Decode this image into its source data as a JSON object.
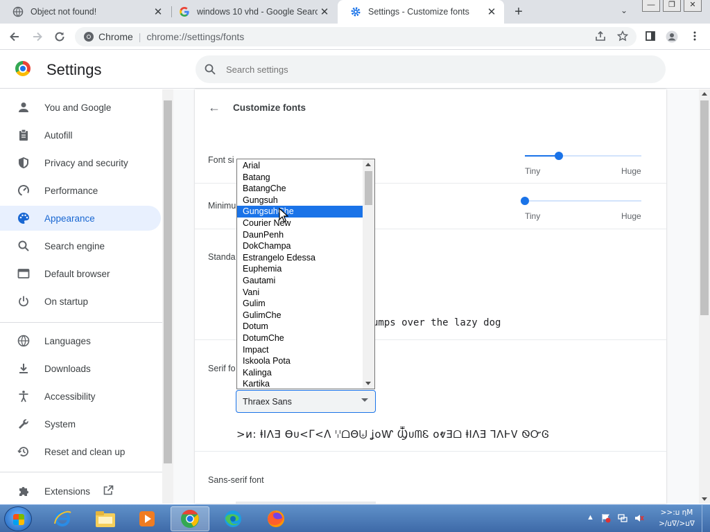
{
  "tabs": [
    {
      "title": "Object not found!",
      "icon": "globe-icon"
    },
    {
      "title": "windows 10 vhd - Google Search",
      "icon": "google-g-icon"
    },
    {
      "title": "Settings - Customize fonts",
      "icon": "gear-icon"
    }
  ],
  "tab_close": "✕",
  "new_tab": "+",
  "tab_search": "⌄",
  "window_controls": {
    "minimize": "—",
    "restore": "❐",
    "close": "✕"
  },
  "omnibox": {
    "chip": "Chrome",
    "url": "chrome://settings/fonts"
  },
  "settings": {
    "title": "Settings",
    "search_placeholder": "Search settings"
  },
  "sidebar": {
    "items": [
      {
        "label": "You and Google",
        "icon": "person-icon"
      },
      {
        "label": "Autofill",
        "icon": "clipboard-icon"
      },
      {
        "label": "Privacy and security",
        "icon": "shield-icon"
      },
      {
        "label": "Performance",
        "icon": "speedometer-icon"
      },
      {
        "label": "Appearance",
        "icon": "palette-icon"
      },
      {
        "label": "Search engine",
        "icon": "search-icon"
      },
      {
        "label": "Default browser",
        "icon": "browser-window-icon"
      },
      {
        "label": "On startup",
        "icon": "power-icon"
      },
      {
        "label": "Languages",
        "icon": "globe-icon"
      },
      {
        "label": "Downloads",
        "icon": "download-icon"
      },
      {
        "label": "Accessibility",
        "icon": "accessibility-icon"
      },
      {
        "label": "System",
        "icon": "wrench-icon"
      },
      {
        "label": "Reset and clean up",
        "icon": "history-icon"
      },
      {
        "label": "Extensions",
        "icon": "puzzle-icon"
      }
    ],
    "active": "Appearance"
  },
  "page": {
    "back_arrow": "←",
    "title": "Customize fonts",
    "font_size_label": "Font si",
    "min_font_label": "Minimu",
    "standard_label": "Standa",
    "serif_label": "Serif fo",
    "sans_label": "Sans-serif font",
    "slider_tiny": "Tiny",
    "slider_huge": "Huge",
    "font_size_value": 0.29,
    "min_font_value": 0.0,
    "standard_sample": "umps over the lazy dog",
    "serif_selected": "Thraex Sans",
    "serif_sample": ">ᴎ: ⱡIⴷƎ Ɵᴜ<ᒥ<ᐱ ꗷᗝΘ⨄ ʝᴏⱲ ⳂᴜᗰᏋ ᴏⱴƎᗝ ⱡIⴷƎ ⅂ⴷⱵᏙ ᏫᏅᎶ"
  },
  "font_dropdown": {
    "options": [
      "Arial",
      "Batang",
      "BatangChe",
      "Gungsuh",
      "GungsuhChe",
      "Courier New",
      "DaunPenh",
      "DokChampa",
      "Estrangelo Edessa",
      "Euphemia",
      "Gautami",
      "Vani",
      "Gulim",
      "GulimChe",
      "Dotum",
      "DotumChe",
      "Impact",
      "Iskoola Pota",
      "Kalinga",
      "Kartika"
    ],
    "highlighted": "GungsuhChe"
  },
  "taskbar": {
    "items": [
      "internet-explorer-icon",
      "file-explorer-icon",
      "media-player-icon",
      "chrome-icon",
      "edge-icon",
      "firefox-icon"
    ],
    "clock_line1": ">>:ⳙ ηM",
    "clock_line2": ">/ⳙ∇/>ⳙ∇"
  },
  "colors": {
    "accent": "#1a73e8",
    "active_nav_bg": "#e8f0fe",
    "active_nav_text": "#1967d2"
  }
}
